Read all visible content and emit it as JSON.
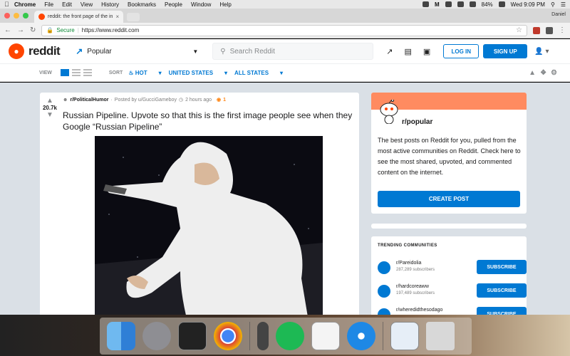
{
  "menubar": {
    "items": [
      "Chrome",
      "File",
      "Edit",
      "View",
      "History",
      "Bookmarks",
      "People",
      "Window",
      "Help"
    ],
    "battery": "84%",
    "clock": "Wed 9:09 PM"
  },
  "browser": {
    "tab_title": "reddit: the front page of the in",
    "profile": "Daniel",
    "secure_label": "Secure",
    "url": "https://www.reddit.com"
  },
  "header": {
    "wordmark": "reddit",
    "feed": "Popular",
    "search_placeholder": "Search Reddit",
    "login": "LOG IN",
    "signup": "SIGN UP"
  },
  "sortbar": {
    "view_label": "VIEW",
    "sort_label": "SORT",
    "sort_value": "HOT",
    "region": "UNITED STATES",
    "states": "ALL STATES"
  },
  "post": {
    "votes": "20.7k",
    "subreddit": "r/PoliticalHumor",
    "posted_by": "Posted by u/GucciGameboy",
    "time": "2 hours ago",
    "gold_count": "1",
    "title": "Russian Pipeline. Upvote so that this is the first image people see when they Google “Russian Pipeline”"
  },
  "sidebar": {
    "community_name": "r/popular",
    "description": "The best posts on Reddit for you, pulled from the most active communities on Reddit. Check here to see the most shared, upvoted, and commented content on the internet.",
    "create_post": "CREATE POST",
    "trending_header": "TRENDING COMMUNITIES",
    "communities": [
      {
        "name": "r/Pareidolia",
        "subscribers": "287,289 subscribers",
        "button": "SUBSCRIBE"
      },
      {
        "name": "r/hardcoreaww",
        "subscribers": "197,489 subscribers",
        "button": "SUBSCRIBE"
      },
      {
        "name": "r/wheredidthesodago",
        "subscribers": "",
        "button": "SUBSCRIBE"
      }
    ]
  },
  "colors": {
    "reddit_orange": "#ff4500",
    "reddit_blue": "#0079d3",
    "page_bg": "#dae0e6"
  },
  "dock": {
    "apps": [
      "finder-icon",
      "launchpad-icon",
      "terminal-icon",
      "chrome-icon",
      "phone-icon",
      "spotify-icon",
      "textedit-icon",
      "safari-icon",
      "preview-icon",
      "trash-icon"
    ]
  }
}
